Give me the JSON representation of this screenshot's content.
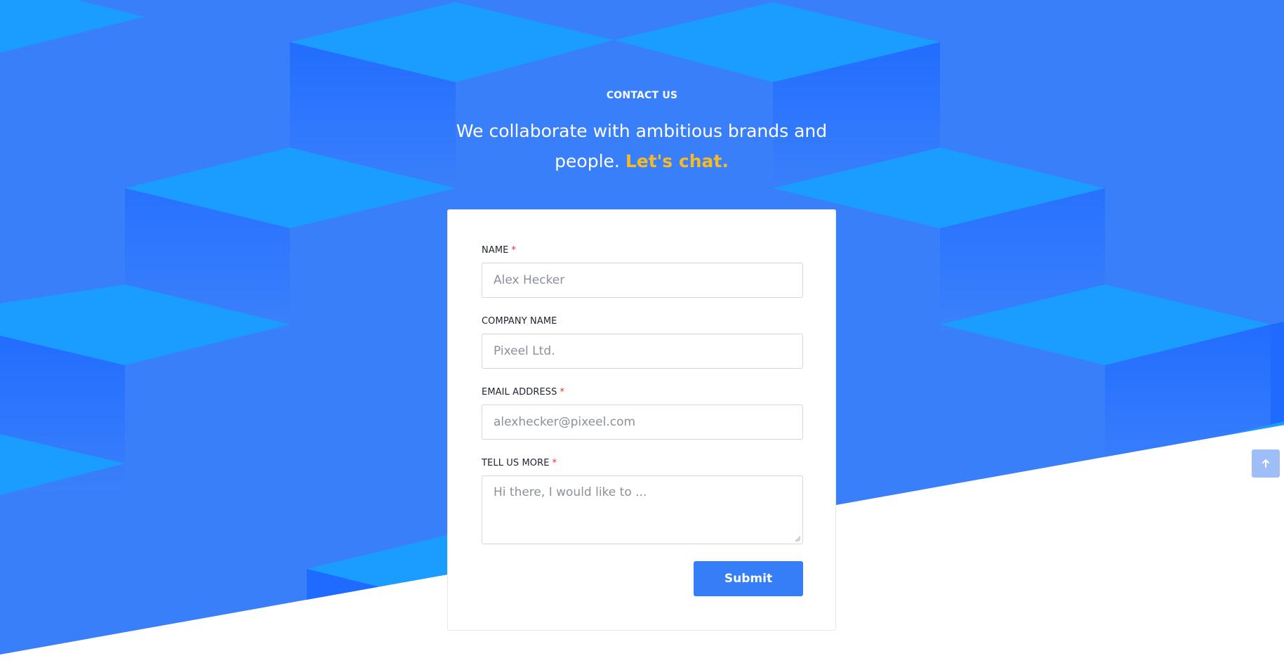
{
  "hero": {
    "eyebrow": "CONTACT US",
    "headline_line1": "We collaborate with ambitious brands and",
    "headline_line2": "people.",
    "headline_accent": "Let's chat."
  },
  "form": {
    "name": {
      "label": "NAME",
      "required_mark": "*",
      "placeholder": "Alex Hecker"
    },
    "company": {
      "label": "COMPANY NAME",
      "placeholder": "Pixeel Ltd."
    },
    "email": {
      "label": "EMAIL ADDRESS",
      "required_mark": "*",
      "placeholder": "alexhecker@pixeel.com"
    },
    "message": {
      "label": "TELL US MORE",
      "required_mark": "*",
      "placeholder": "Hi there, I would like to ..."
    },
    "submit_label": "Submit"
  },
  "scroll_top": {
    "icon": "arrow-up-icon"
  },
  "colors": {
    "hero_blue": "#357ef7",
    "accent_yellow": "#f7b928",
    "required_red": "#e0322d",
    "button_blue": "#357ef7"
  }
}
